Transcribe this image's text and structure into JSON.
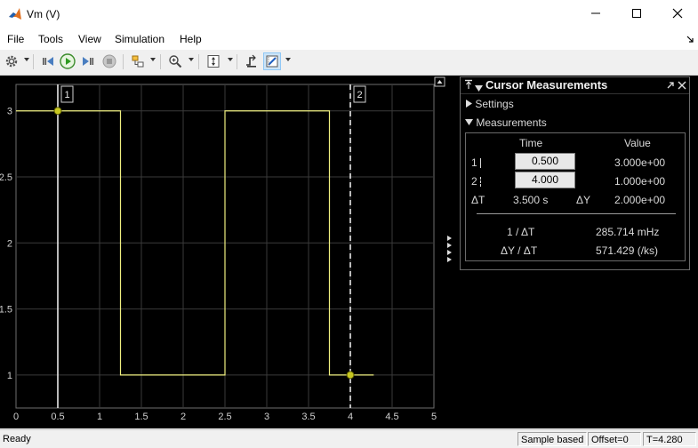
{
  "window": {
    "title": "Vm (V)"
  },
  "menu": {
    "items": [
      "File",
      "Tools",
      "View",
      "Simulation",
      "Help"
    ]
  },
  "toolbar": {
    "icons": [
      "gear-icon",
      "step-back-icon",
      "run-icon",
      "step-forward-icon",
      "stop-icon",
      "highlight-block-icon",
      "zoom-icon",
      "scale-axes-icon",
      "triggers-icon",
      "cursor-measurements-icon"
    ],
    "active": "cursor-measurements-icon"
  },
  "chart_data": {
    "type": "line",
    "title": "",
    "xlabel": "",
    "ylabel": "",
    "xlim": [
      0,
      5
    ],
    "ylim": [
      0.75,
      3.2
    ],
    "x_ticks": [
      "0",
      "0.5",
      "1",
      "1.5",
      "2",
      "2.5",
      "3",
      "3.5",
      "4",
      "4.5",
      "5"
    ],
    "y_ticks": [
      "1",
      "1.5",
      "2",
      "2.5",
      "3"
    ],
    "grid": true,
    "background": "#000000",
    "line_color": "#f0f080",
    "series": [
      {
        "x": [
          0,
          1.25,
          1.25,
          2.5,
          2.5,
          3.75,
          3.75,
          4.28
        ],
        "y": [
          3,
          3,
          1,
          1,
          3,
          3,
          1,
          1
        ]
      }
    ],
    "cursors": [
      {
        "label": "1",
        "x": 0.5,
        "y": 3,
        "style": "solid"
      },
      {
        "label": "2",
        "x": 4.0,
        "y": 1,
        "style": "dashed"
      }
    ]
  },
  "cursor_panel": {
    "title": "Cursor Measurements",
    "settings_label": "Settings",
    "measurements_label": "Measurements",
    "col_time": "Time",
    "col_value": "Value",
    "rows": [
      {
        "label": "1",
        "time": "0.500",
        "value": "3.000e+00"
      },
      {
        "label": "2",
        "time": "4.000",
        "value": "1.000e+00"
      }
    ],
    "delta_t_label": "ΔT",
    "delta_t": "3.500 s",
    "delta_y_label": "ΔY",
    "delta_y": "2.000e+00",
    "inv_dt_label": "1 / ΔT",
    "inv_dt": "285.714 mHz",
    "dy_dt_label": "ΔY / ΔT",
    "dy_dt": "571.429 (/ks)"
  },
  "status": {
    "ready": "Ready",
    "mode": "Sample based",
    "offset": "Offset=0",
    "time": "T=4.280"
  }
}
